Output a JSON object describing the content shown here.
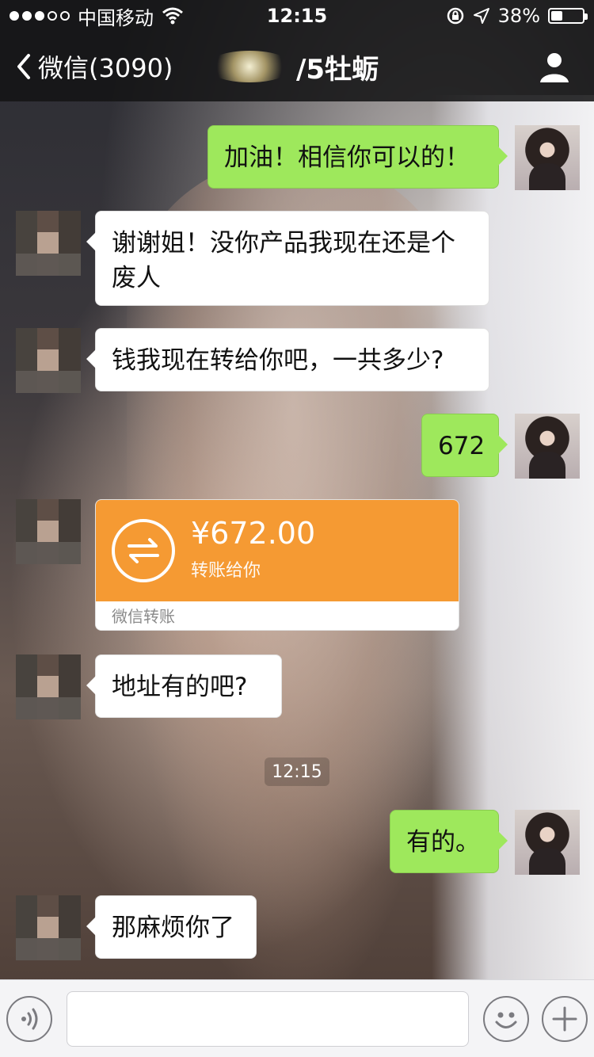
{
  "statusbar": {
    "carrier": "中国移动",
    "time": "12:15",
    "battery_percent": "38%",
    "battery_level": 0.38
  },
  "navbar": {
    "back_label": "微信(3090)",
    "title_visible": "/5牡蛎",
    "profile_icon": "profile-icon"
  },
  "messages": [
    {
      "side": "out",
      "text": "加油！相信你可以的！"
    },
    {
      "side": "in",
      "text": "谢谢姐！没你产品我现在还是个废人"
    },
    {
      "side": "in",
      "text": "钱我现在转给你吧，一共多少?"
    },
    {
      "side": "out",
      "text": "672"
    },
    {
      "side": "in",
      "type": "transfer",
      "amount": "¥672.00",
      "desc": "转账给你",
      "footer": "微信转账"
    },
    {
      "side": "in",
      "text": "地址有的吧?"
    },
    {
      "type": "timestamp",
      "text": "12:15"
    },
    {
      "side": "out",
      "text": "有的。"
    },
    {
      "side": "in",
      "text": "那麻烦你了"
    }
  ],
  "inputbar": {
    "voice_icon": "voice-icon",
    "emoji_icon": "emoji-icon",
    "plus_icon": "plus-icon",
    "input_value": ""
  },
  "colors": {
    "outgoing_bubble": "#9ee85c",
    "incoming_bubble": "#ffffff",
    "transfer_orange": "#f59a33",
    "bar_background": "#141416"
  }
}
